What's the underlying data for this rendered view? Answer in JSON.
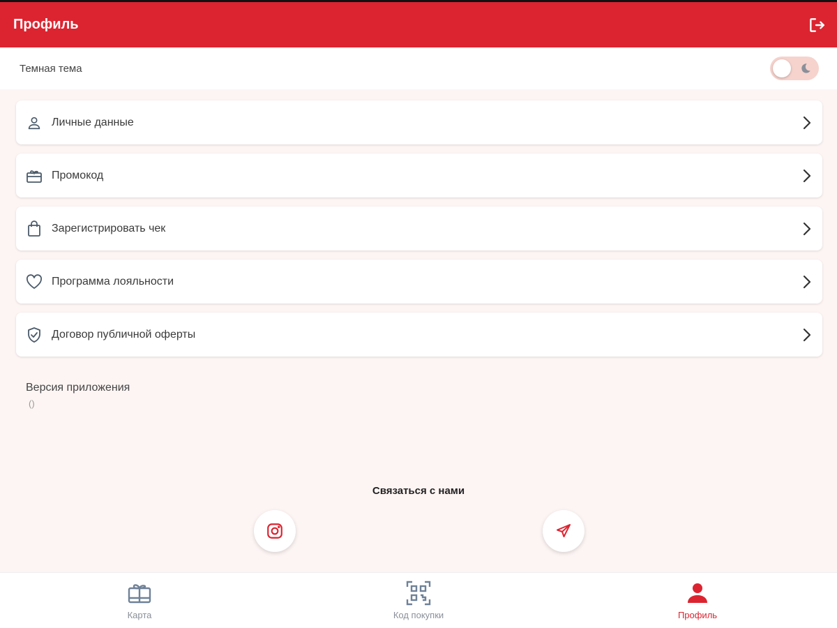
{
  "header": {
    "title": "Профиль",
    "logout_icon": "logout-icon"
  },
  "theme": {
    "label": "Темная тема",
    "enabled": false
  },
  "menu": {
    "items": [
      {
        "label": "Личные данные",
        "icon": "person-icon"
      },
      {
        "label": "Промокод",
        "icon": "gift-icon"
      },
      {
        "label": "Зарегистрировать чек",
        "icon": "shopping-bag-icon"
      },
      {
        "label": "Программа лояльности",
        "icon": "heart-icon"
      },
      {
        "label": "Договор публичной оферты",
        "icon": "shield-check-icon"
      }
    ]
  },
  "version": {
    "label": "Версия приложения",
    "value": "()"
  },
  "contact": {
    "title": "Связаться с нами"
  },
  "nav": {
    "items": [
      {
        "label": "Карта",
        "icon": "card-gift-icon",
        "active": false
      },
      {
        "label": "Код покупки",
        "icon": "qr-code-icon",
        "active": false
      },
      {
        "label": "Профиль",
        "icon": "profile-icon",
        "active": true
      }
    ]
  },
  "colors": {
    "accent": "#dc2430",
    "background": "#fdf5f4",
    "toggle_track": "#f6d3cd",
    "nav_inactive": "#8a8f99"
  }
}
